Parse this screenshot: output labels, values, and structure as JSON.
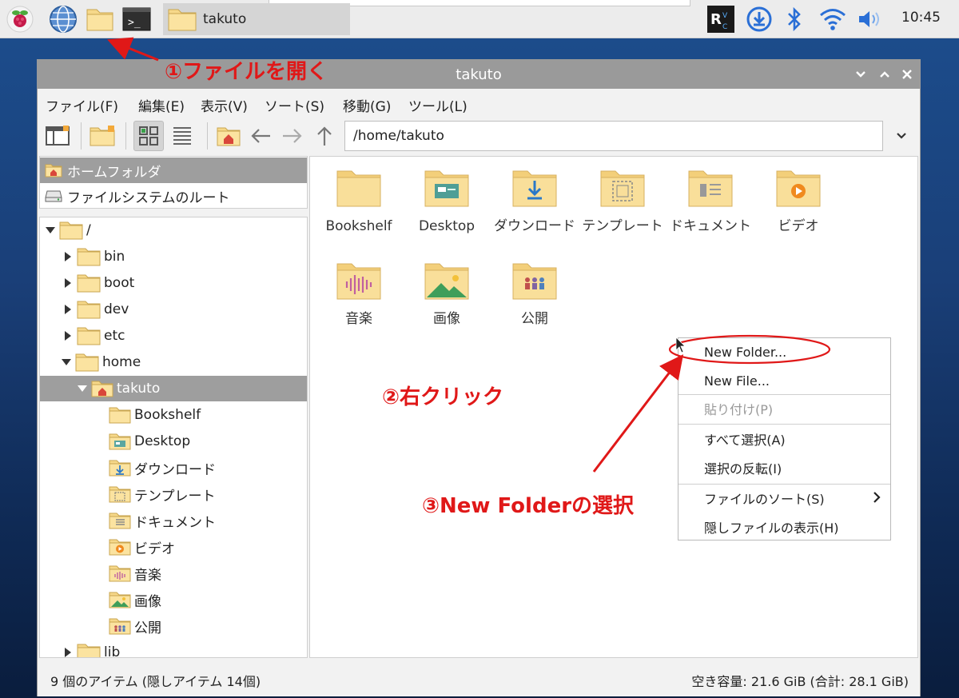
{
  "taskbar": {
    "task_label": "takuto",
    "clock": "10:45"
  },
  "annotations": {
    "step1": "①ファイルを開く",
    "step2": "②右クリック",
    "step3": "③New Folderの選択"
  },
  "window": {
    "title": "takuto"
  },
  "menubar": {
    "items": [
      "ファイル(F)",
      "編集(E)",
      "表示(V)",
      "ソート(S)",
      "移動(G)",
      "ツール(L)"
    ]
  },
  "toolbar": {
    "path": "/home/takuto"
  },
  "places": {
    "items": [
      {
        "label": "ホームフォルダ",
        "icon": "home-folder-icon"
      },
      {
        "label": "ファイルシステムのルート",
        "icon": "drive-icon"
      }
    ]
  },
  "tree": {
    "rows": [
      {
        "label": "/",
        "expander": "expanded"
      },
      {
        "label": "bin",
        "expander": "collapsed"
      },
      {
        "label": "boot",
        "expander": "collapsed"
      },
      {
        "label": "dev",
        "expander": "collapsed"
      },
      {
        "label": "etc",
        "expander": "collapsed"
      },
      {
        "label": "home",
        "expander": "expanded"
      },
      {
        "label": "takuto",
        "expander": "expanded"
      },
      {
        "label": "Bookshelf",
        "expander": "none"
      },
      {
        "label": "Desktop",
        "expander": "none"
      },
      {
        "label": "ダウンロード",
        "expander": "none"
      },
      {
        "label": "テンプレート",
        "expander": "none"
      },
      {
        "label": "ドキュメント",
        "expander": "none"
      },
      {
        "label": "ビデオ",
        "expander": "none"
      },
      {
        "label": "音楽",
        "expander": "none"
      },
      {
        "label": "画像",
        "expander": "none"
      },
      {
        "label": "公開",
        "expander": "none"
      },
      {
        "label": "lib",
        "expander": "collapsed"
      }
    ]
  },
  "files": {
    "items": [
      {
        "name": "Bookshelf",
        "icon": "folder-icon"
      },
      {
        "name": "Desktop",
        "icon": "desktop-folder-icon"
      },
      {
        "name": "ダウンロード",
        "icon": "download-folder-icon"
      },
      {
        "name": "テンプレート",
        "icon": "template-folder-icon"
      },
      {
        "name": "ドキュメント",
        "icon": "document-folder-icon"
      },
      {
        "name": "ビデオ",
        "icon": "video-folder-icon"
      },
      {
        "name": "音楽",
        "icon": "music-folder-icon"
      },
      {
        "name": "画像",
        "icon": "pictures-folder-icon"
      },
      {
        "name": "公開",
        "icon": "public-folder-icon"
      }
    ]
  },
  "context_menu": {
    "new_folder": "New Folder...",
    "new_file": "New File...",
    "paste": "貼り付け(P)",
    "select_all": "すべて選択(A)",
    "invert_selection": "選択の反転(I)",
    "sort_files": "ファイルのソート(S)",
    "show_hidden": "隠しファイルの表示(H)"
  },
  "statusbar": {
    "left": "9 個のアイテム (隠しアイテム 14個)",
    "right": "空き容量: 21.6 GiB (合計: 28.1 GiB)"
  },
  "colors": {
    "annotation": "#e01818",
    "folder": "#f6d88a",
    "selection": "#9e9e9e"
  }
}
